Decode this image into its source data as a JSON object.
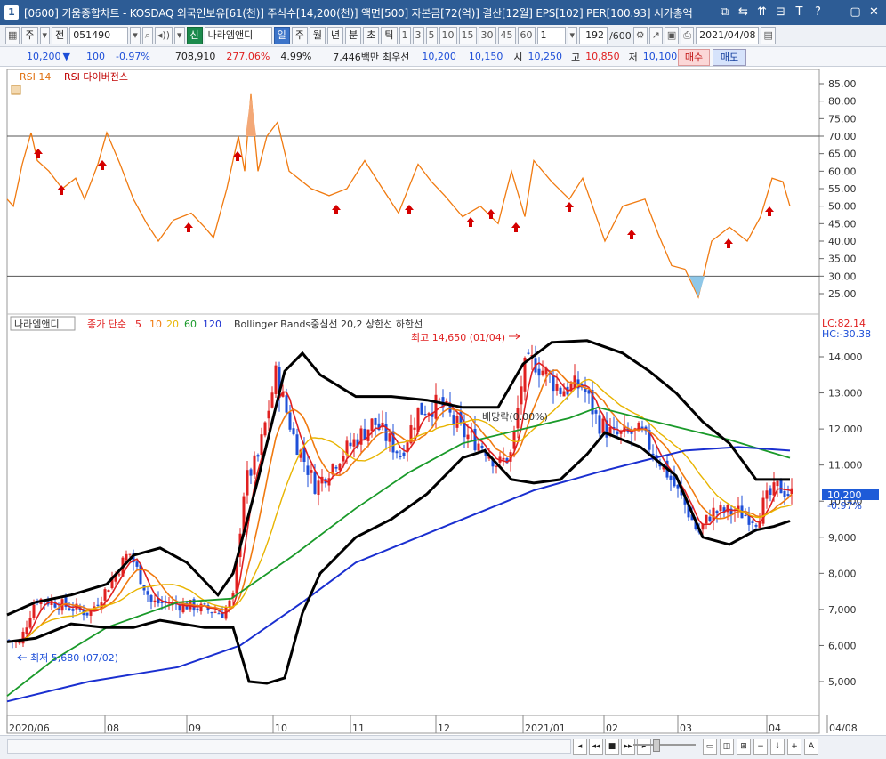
{
  "title": {
    "app_icon": "1",
    "text": "[0600] 키움종합차트 - KOSDAQ 외국인보유[61(천)] 주식수[14,200(천)] 액면[500] 자본금[72(억)] 결산[12월] EPS[102] PER[100.93] 시가총액",
    "buttons": [
      "⧉",
      "⇆",
      "⇈",
      "⊟",
      "T",
      "?",
      "—",
      "▢",
      "✕"
    ]
  },
  "toolbar": {
    "items": [
      "주",
      "전",
      "051490",
      "신",
      "나라엠앤디",
      "일",
      "주",
      "월",
      "년",
      "분",
      "초",
      "틱",
      "1",
      "3",
      "5",
      "10",
      "15",
      "30",
      "45",
      "60",
      "1",
      "192",
      "/600",
      "2021/04/08"
    ]
  },
  "quote": {
    "price": "10,200",
    "change": "100",
    "rate": "-0.97%",
    "volume": "708,910",
    "vol_rate": "277.06%",
    "turnover": "4.99%",
    "amount": "7,446백만",
    "bid_label": "최우선",
    "bid1": "10,200",
    "bid2": "10,150",
    "open_label": "시",
    "open": "10,250",
    "high_label": "고",
    "high": "10,850",
    "low_label": "저",
    "low": "10,100",
    "buy": "매수",
    "sell": "매도"
  },
  "rsi_panel": {
    "label_rsi": "RSI 14",
    "label_div": "RSI 다이버전스",
    "y_ticks": [
      "85.00",
      "80.00",
      "75.00",
      "70.00",
      "65.00",
      "60.00",
      "55.00",
      "50.00",
      "45.00",
      "40.00",
      "35.00",
      "30.00",
      "25.00"
    ]
  },
  "price_panel": {
    "legend_name": "나라엠앤디",
    "legend_ma": "종가 단순",
    "ma_periods": [
      "5",
      "10",
      "20",
      "60",
      "120"
    ],
    "legend_bb": "Bollinger Bands중심선 20,2 상한선 하한선",
    "high_note": "최고 14,650 (01/04)",
    "low_note": "최저 5,680 (07/02)",
    "dividend_note": "배당락(0.00%)",
    "lc": "LC:82.14",
    "hc": "HC:-30.38",
    "current": "10,200",
    "current_rate": "-0.97%",
    "y_ticks": [
      "14,000",
      "13,000",
      "12,000",
      "11,000",
      "10,000",
      "9,000",
      "8,000",
      "7,000",
      "6,000",
      "5,000"
    ]
  },
  "x_axis": [
    "2020/06",
    "08",
    "09",
    "10",
    "11",
    "12",
    "2021/01",
    "02",
    "03",
    "04",
    "04/08"
  ],
  "colors": {
    "ma5": "#e02020",
    "ma10": "#f07a10",
    "ma20": "#e8b400",
    "ma60": "#1a9a2a",
    "ma120": "#1a2fd0",
    "bb": "#000000",
    "rsi": "#f07a10",
    "up": "#e02020",
    "down": "#1e4fd8"
  },
  "chart_data": {
    "type": "candlestick",
    "x": [
      "2020/06",
      "2020/07",
      "2020/08",
      "2020/09",
      "2020/10",
      "2020/11",
      "2020/12",
      "2021/01",
      "2021/02",
      "2021/03",
      "2021/04"
    ],
    "close_approx": [
      6200,
      7100,
      8300,
      7200,
      12200,
      11200,
      12000,
      13500,
      12000,
      9500,
      10200
    ],
    "rsi_approx": [
      50,
      65,
      52,
      45,
      72,
      55,
      52,
      54,
      45,
      28,
      50
    ],
    "ylim_price": [
      4500,
      14900
    ],
    "ylim_rsi": [
      22,
      87
    ]
  }
}
